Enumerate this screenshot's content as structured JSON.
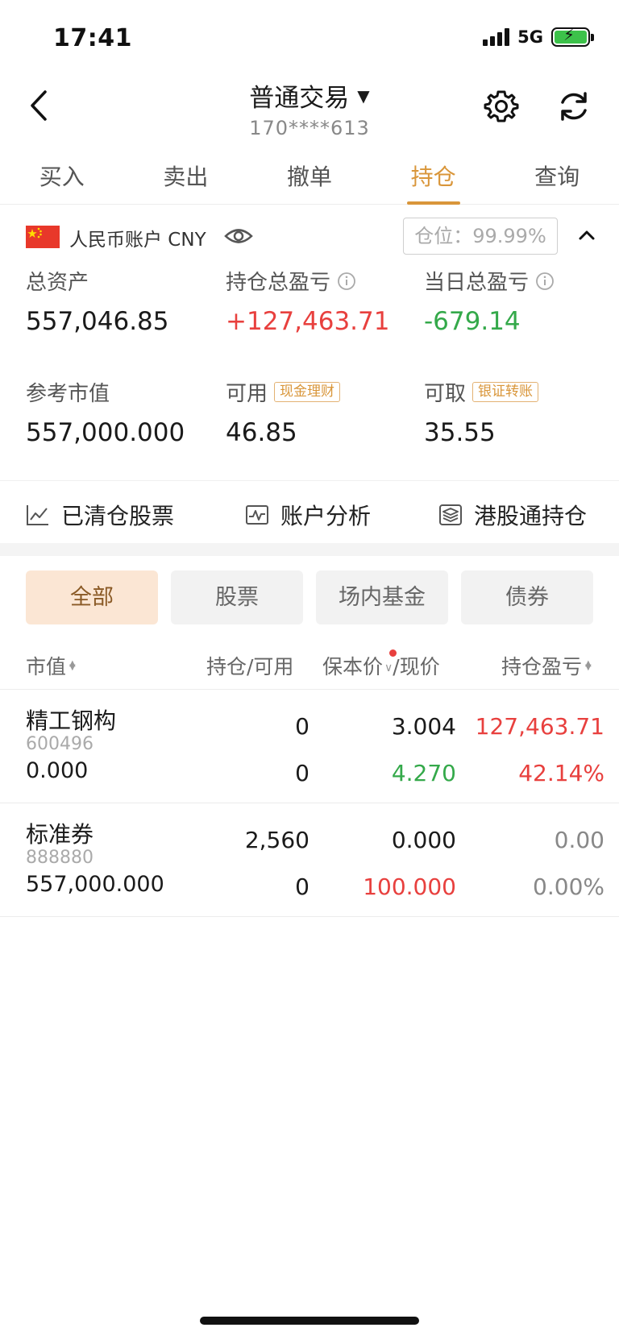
{
  "status": {
    "time": "17:41",
    "network": "5G"
  },
  "header": {
    "title": "普通交易",
    "account_masked": "170****613"
  },
  "tabs": [
    {
      "label": "买入",
      "active": false
    },
    {
      "label": "卖出",
      "active": false
    },
    {
      "label": "撤单",
      "active": false
    },
    {
      "label": "持仓",
      "active": true
    },
    {
      "label": "查询",
      "active": false
    }
  ],
  "account": {
    "label": "人民币账户 CNY",
    "position_ratio": "仓位：99.99%"
  },
  "stats": {
    "total_assets": {
      "label": "总资产",
      "value": "557,046.85"
    },
    "holding_pnl": {
      "label": "持仓总盈亏",
      "value": "+127,463.71"
    },
    "daily_pnl": {
      "label": "当日总盈亏",
      "value": "-679.14"
    },
    "market_value": {
      "label": "参考市值",
      "value": "557,000.000"
    },
    "available": {
      "label": "可用",
      "value": "46.85",
      "tag": "现金理财"
    },
    "withdrawable": {
      "label": "可取",
      "value": "35.55",
      "tag": "银证转账"
    }
  },
  "quick_links": [
    {
      "label": "已清仓股票",
      "icon": "line-chart-icon"
    },
    {
      "label": "账户分析",
      "icon": "analysis-icon"
    },
    {
      "label": "港股通持仓",
      "icon": "layers-icon"
    }
  ],
  "filters": [
    {
      "label": "全部",
      "active": true
    },
    {
      "label": "股票",
      "active": false
    },
    {
      "label": "场内基金",
      "active": false
    },
    {
      "label": "债券",
      "active": false
    }
  ],
  "table_header": {
    "market_value": "市值",
    "holding": "持仓/可用",
    "cost_price": "保本价",
    "current_price": "/现价",
    "pnl": "持仓盈亏"
  },
  "rows": [
    {
      "name": "精工钢构",
      "code": "600496",
      "market_value": "0.000",
      "holding": "0",
      "available": "0",
      "cost_price": "3.004",
      "current_price": "4.270",
      "pnl": "127,463.71",
      "pnl_pct": "42.14%"
    },
    {
      "name": "标准券",
      "code": "888880",
      "market_value": "557,000.000",
      "holding": "2,560",
      "available": "0",
      "cost_price": "0.000",
      "current_price": "100.000",
      "pnl": "0.00",
      "pnl_pct": "0.00%"
    }
  ],
  "colors": {
    "accent": "#d9963a",
    "up": "#e8403e",
    "down": "#34a94a"
  }
}
